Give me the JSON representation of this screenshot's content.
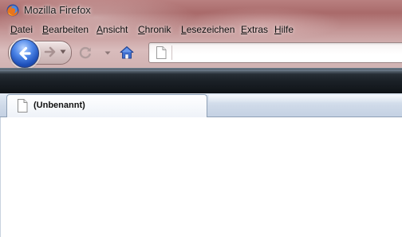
{
  "window": {
    "title": "Mozilla Firefox",
    "logo_icon": "firefox-logo-icon"
  },
  "menu": {
    "items": [
      {
        "label": "Datei",
        "accesskey": "D"
      },
      {
        "label": "Bearbeiten",
        "accesskey": "B"
      },
      {
        "label": "Ansicht",
        "accesskey": "A"
      },
      {
        "label": "Chronik",
        "accesskey": "C"
      },
      {
        "label": "Lesezeichen",
        "accesskey": "L"
      },
      {
        "label": "Extras",
        "accesskey": "E"
      },
      {
        "label": "Hilfe",
        "accesskey": "H"
      }
    ]
  },
  "navbar": {
    "back_icon": "back-arrow-icon",
    "forward_icon": "forward-arrow-icon",
    "history_dropdown_icon": "chevron-down-icon",
    "reload_icon": "reload-icon",
    "reload_dropdown_icon": "chevron-down-icon",
    "home_icon": "home-icon",
    "url": {
      "value": "",
      "placeholder": "",
      "page_icon": "blank-page-icon"
    }
  },
  "tabs": [
    {
      "label": "(Unbenannt)",
      "icon": "blank-page-icon",
      "selected": true
    }
  ],
  "colors": {
    "frame_tint": "#b98080",
    "back_button": "#1e4fb8",
    "bookmarks_bar": "#1c2228",
    "tabstrip": "#ced9e8"
  }
}
